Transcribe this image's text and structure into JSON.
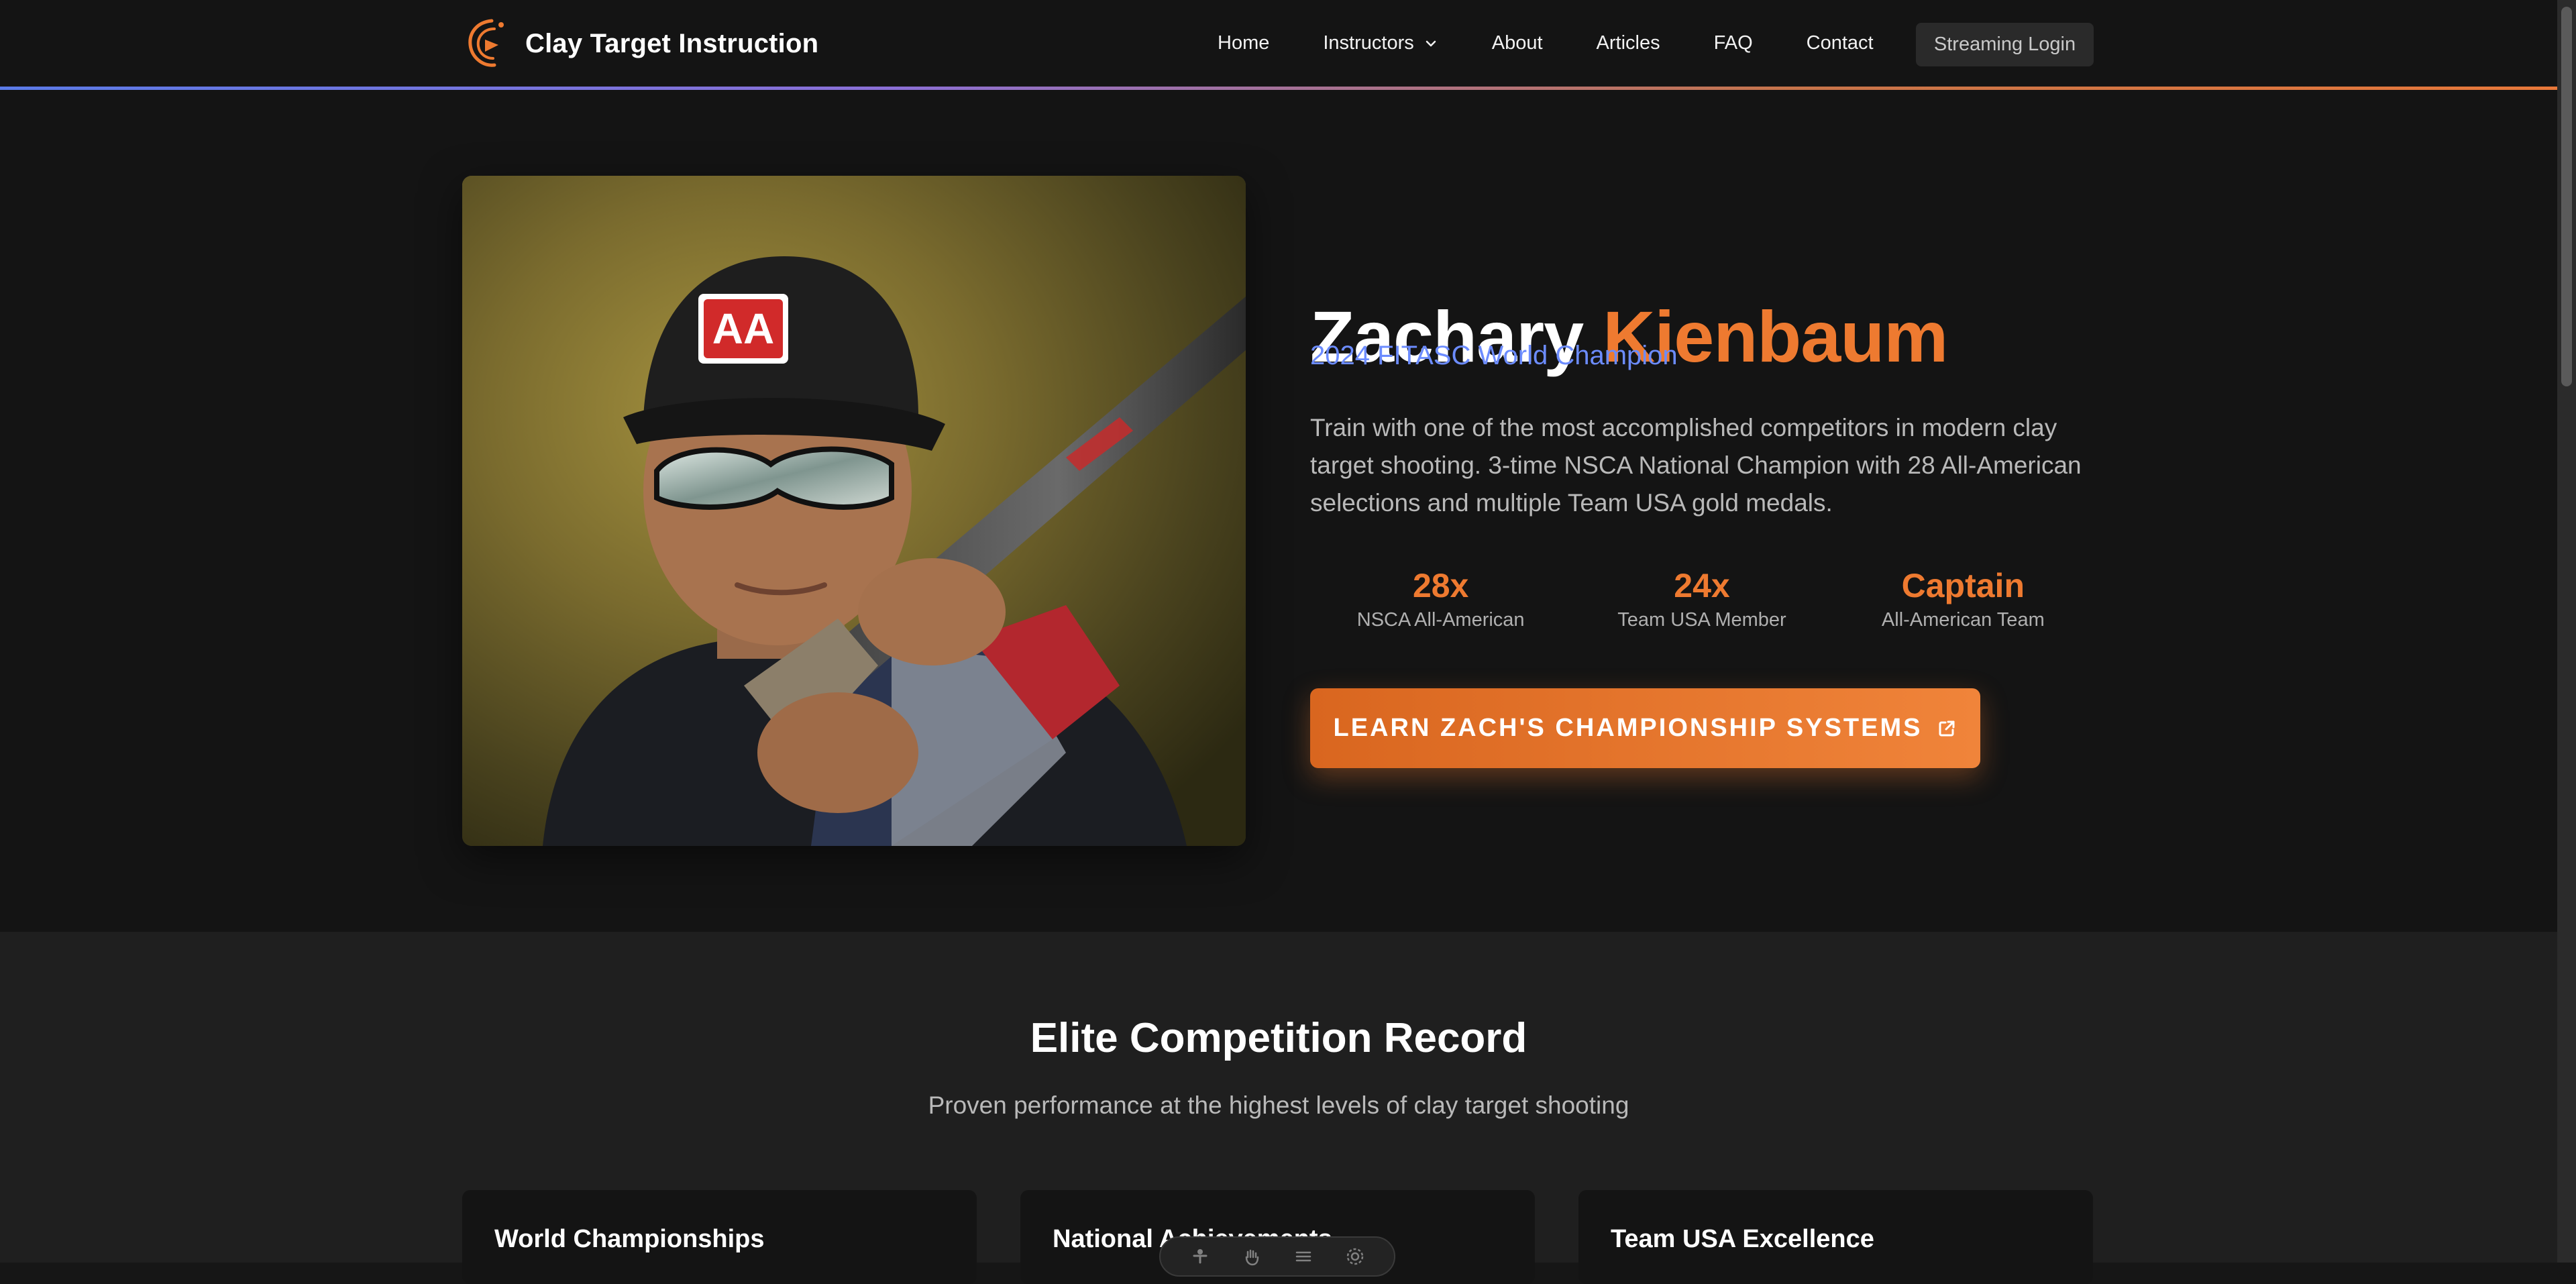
{
  "header": {
    "brand_name": "Clay Target Instruction",
    "nav": {
      "home": "Home",
      "instructors": "Instructors",
      "about": "About",
      "articles": "Articles",
      "faq": "FAQ",
      "contact": "Contact"
    },
    "login_label": "Streaming Login"
  },
  "hero": {
    "first_name": "Zachary",
    "last_name": "Kienbaum",
    "subtitle": "2024 FITASC World Champion",
    "description": "Train with one of the most accomplished competitors in modern clay target shooting. 3-time NSCA National Champion with 28 All-American selections and multiple Team USA gold medals.",
    "stats": [
      {
        "value": "28x",
        "label": "NSCA All-American"
      },
      {
        "value": "24x",
        "label": "Team USA Member"
      },
      {
        "value": "Captain",
        "label": "All-American Team"
      }
    ],
    "cta_label": "LEARN ZACH'S CHAMPIONSHIP SYSTEMS",
    "cap_logo_text": "AA"
  },
  "record": {
    "title": "Elite Competition Record",
    "subtitle": "Proven performance at the highest levels of clay target shooting",
    "cards": [
      {
        "title": "World Championships"
      },
      {
        "title": "National Achievements"
      },
      {
        "title": "Team USA Excellence"
      }
    ]
  },
  "colors": {
    "accent_orange": "#ee7a30",
    "accent_blue": "#6c8cff",
    "background": "#141414",
    "section_background": "#1f1f1f"
  },
  "icons": {
    "logo": "clay-target-logo-icon",
    "dropdown": "chevron-down-icon",
    "cta": "external-link-icon"
  }
}
